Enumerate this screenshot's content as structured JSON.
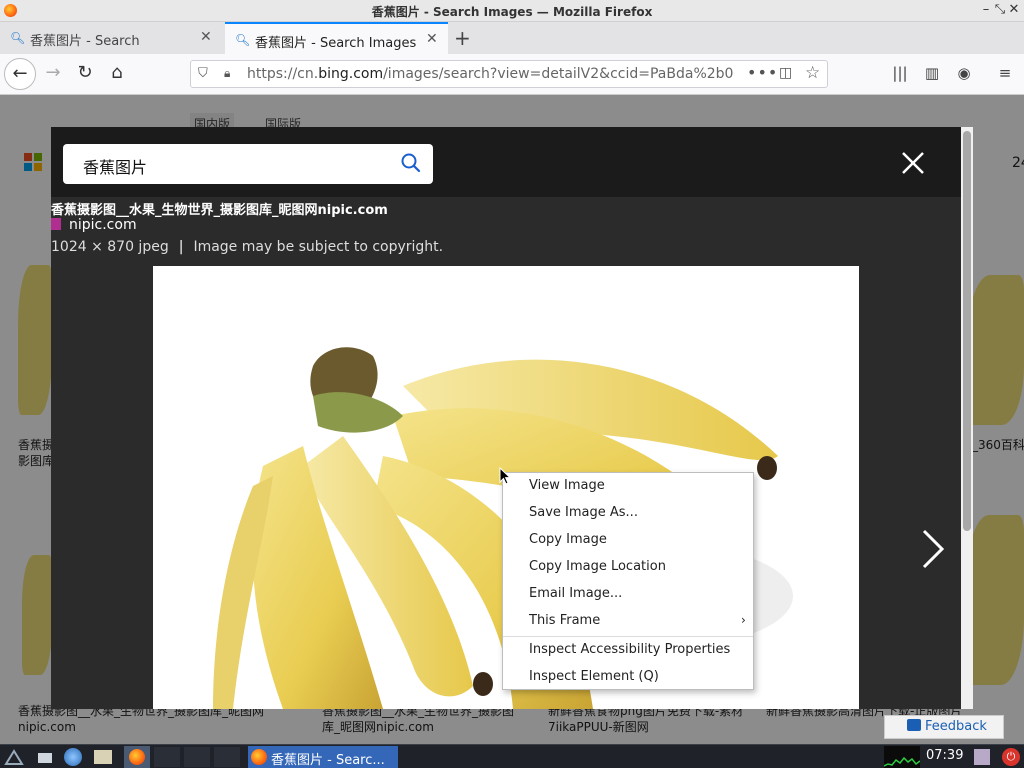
{
  "window": {
    "title": "香蕉图片 - Search Images — Mozilla Firefox"
  },
  "tabs": [
    {
      "label": "香蕉图片 - Search",
      "active": false
    },
    {
      "label": "香蕉图片 - Search Images",
      "active": true
    }
  ],
  "navbar": {
    "url_prefix": "https://cn.",
    "url_host": "bing.com",
    "url_rest": "/images/search?view=detailV2&ccid=PaBda%2b0",
    "more": "•••"
  },
  "page": {
    "markets": [
      "国内版",
      "国际版"
    ],
    "bg_partial_number": "24",
    "bg_captions": [
      "香蕉摄",
      "影图库",
      "_360百科",
      "香蕉摄影图__水果_生物世界_摄影图库_昵图网",
      "nipic.com",
      "香蕉摄影图__水果_生物世界_摄影图",
      "库_昵图网nipic.com",
      "新鲜香蕉食物png图片免费下载-素材",
      "7iikaPPUU-新图网",
      "新鲜香蕉摄影高清图片下载-正版图片"
    ],
    "feedback_label": "Feedback"
  },
  "modal": {
    "search_query": "香蕉图片",
    "image_title": "香蕉摄影图__水果_生物世界_摄影图库_昵图网nipic.com",
    "site_name": "nipic.com",
    "dimensions": "1024 × 870 jpeg",
    "separator": "|",
    "copyright": "Image may be subject to copyright."
  },
  "context_menu": {
    "items": [
      {
        "label": "View Image"
      },
      {
        "label": "Save Image As..."
      },
      {
        "label": "Copy Image"
      },
      {
        "label": "Copy Image Location"
      },
      {
        "label": "Email Image..."
      },
      {
        "label": "This Frame",
        "submenu_arrow": "›"
      },
      {
        "label": "Inspect Accessibility Properties"
      },
      {
        "label": "Inspect Element (Q)"
      }
    ]
  },
  "taskbar": {
    "active_task": "香蕉图片 - Searc...",
    "clock": "07:39"
  },
  "colors": {
    "accent": "#0a84ff",
    "modal_bg": "#2b2b2b",
    "taskbar": "#1f2228"
  }
}
